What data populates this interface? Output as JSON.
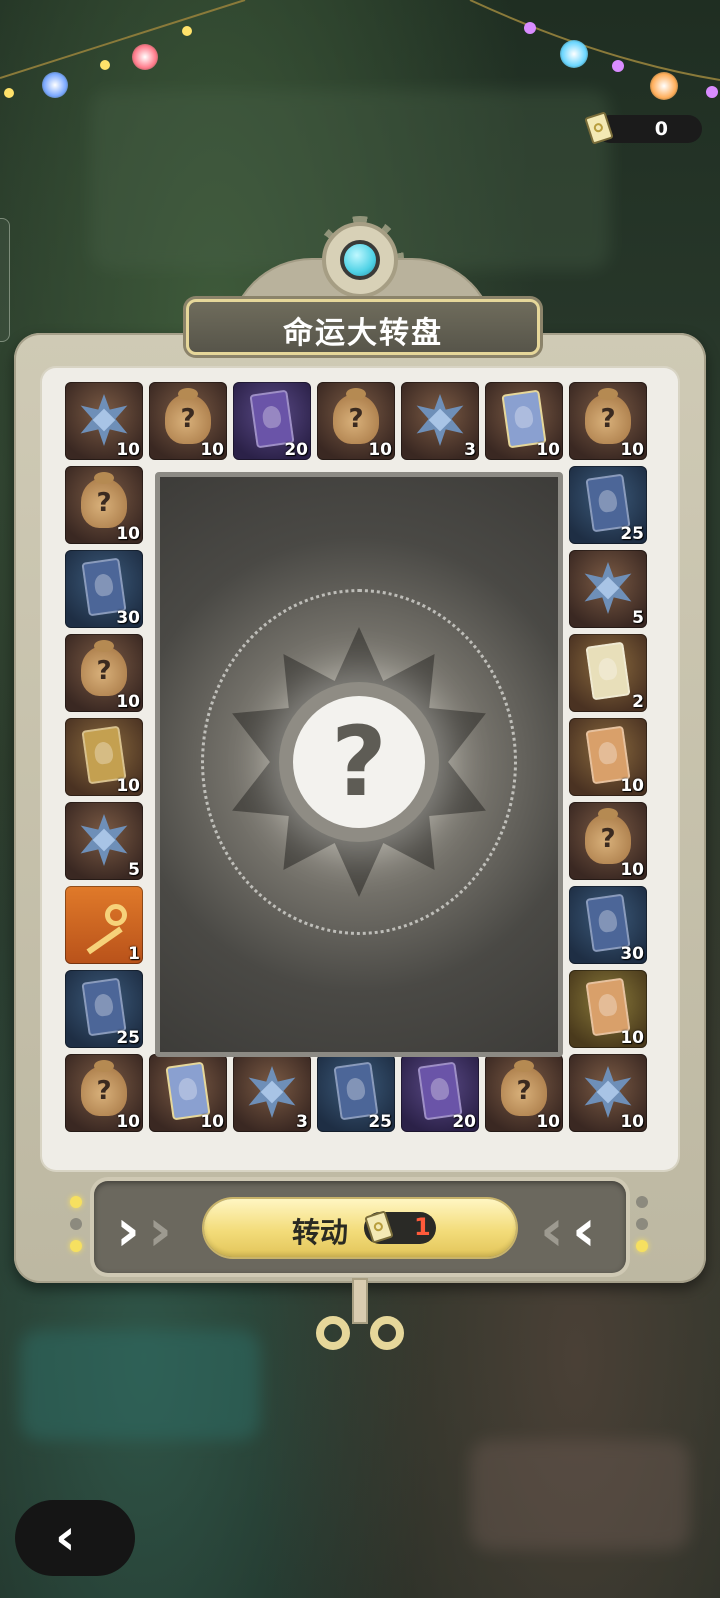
{
  "currency": {
    "icon": "ticket-icon",
    "value": "0"
  },
  "title": "命运大转盘",
  "board": {
    "top_row": [
      {
        "item": "star-emblem",
        "bg": "brown",
        "count": "10"
      },
      {
        "item": "mystery-bag",
        "bg": "brown",
        "count": "10"
      },
      {
        "item": "card-purple",
        "bg": "purple",
        "count": "20"
      },
      {
        "item": "mystery-bag",
        "bg": "brown",
        "count": "10"
      },
      {
        "item": "star-emblem",
        "bg": "brown",
        "count": "3"
      },
      {
        "item": "card-blueframe",
        "bg": "brown",
        "count": "10"
      },
      {
        "item": "mystery-bag",
        "bg": "brown",
        "count": "10"
      }
    ],
    "left_col": [
      {
        "item": "mystery-bag",
        "bg": "brown",
        "count": "10"
      },
      {
        "item": "card-blue",
        "bg": "blue",
        "count": "30"
      },
      {
        "item": "mystery-bag",
        "bg": "brown",
        "count": "10"
      },
      {
        "item": "card-gold",
        "bg": "gold",
        "count": "10"
      },
      {
        "item": "star-emblem",
        "bg": "brown",
        "count": "5"
      },
      {
        "item": "key",
        "bg": "orange",
        "count": "1"
      },
      {
        "item": "card-blue",
        "bg": "blue",
        "count": "25"
      }
    ],
    "right_col": [
      {
        "item": "card-blue",
        "bg": "blue",
        "count": "25"
      },
      {
        "item": "star-emblem",
        "bg": "brown",
        "count": "5"
      },
      {
        "item": "card-cream",
        "bg": "gold",
        "count": "2"
      },
      {
        "item": "card-rose",
        "bg": "gold",
        "count": "10"
      },
      {
        "item": "mystery-bag",
        "bg": "brown",
        "count": "10"
      },
      {
        "item": "card-blue",
        "bg": "blue",
        "count": "30"
      },
      {
        "item": "card-rose",
        "bg": "mustard",
        "count": "10"
      }
    ],
    "bottom_row": [
      {
        "item": "mystery-bag",
        "bg": "brown",
        "count": "10"
      },
      {
        "item": "card-blueframe",
        "bg": "brown",
        "count": "10"
      },
      {
        "item": "star-emblem",
        "bg": "brown",
        "count": "3"
      },
      {
        "item": "card-blue",
        "bg": "blue",
        "count": "25"
      },
      {
        "item": "card-purple",
        "bg": "purple",
        "count": "20"
      },
      {
        "item": "mystery-bag",
        "bg": "brown",
        "count": "10"
      },
      {
        "item": "star-emblem",
        "bg": "brown",
        "count": "10"
      }
    ]
  },
  "center": {
    "symbol": "?"
  },
  "spin": {
    "label": "转动",
    "cost": "1",
    "cost_icon": "ticket-icon"
  },
  "colors": {
    "accent_gold": "#f3dc7a",
    "cost_red": "#ff5a3a",
    "gem_cyan": "#4fd2e6"
  },
  "back": {
    "icon": "chevron-left-icon",
    "glyph": "‹"
  }
}
